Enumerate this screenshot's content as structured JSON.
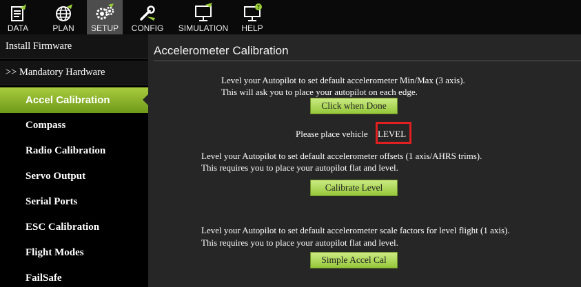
{
  "toolbar": {
    "items": [
      {
        "label": "DATA",
        "icon": "data-icon"
      },
      {
        "label": "PLAN",
        "icon": "globe-icon"
      },
      {
        "label": "SETUP",
        "icon": "gears-icon",
        "active": true
      },
      {
        "label": "CONFIG",
        "icon": "wrench-plane-icon"
      },
      {
        "label": "SIMULATION",
        "icon": "monitor-plane-icon"
      },
      {
        "label": "HELP",
        "icon": "monitor-help-icon"
      }
    ]
  },
  "sidebar": {
    "items": [
      {
        "label": "Install Firmware"
      },
      {
        "label": ">> Mandatory Hardware"
      },
      {
        "label": "Accel Calibration",
        "selected": true
      },
      {
        "label": "Compass"
      },
      {
        "label": "Radio Calibration"
      },
      {
        "label": "Servo Output"
      },
      {
        "label": "Serial Ports"
      },
      {
        "label": "ESC Calibration"
      },
      {
        "label": "Flight Modes"
      },
      {
        "label": "FailSafe"
      }
    ]
  },
  "main": {
    "title": "Accelerometer Calibration",
    "section1": {
      "line1": "Level your Autopilot to set default accelerometer Min/Max (3 axis).",
      "line2": "This will ask you to place your autopilot on each edge.",
      "button": "Click when Done",
      "prompt_text": "Please place vehicle",
      "prompt_value": "LEVEL"
    },
    "section2": {
      "line1": "Level your Autopilot to set default accelerometer offsets (1 axis/AHRS trims).",
      "line2": "This requires you to place your autopilot flat and level.",
      "button": "Calibrate Level"
    },
    "section3": {
      "line1": "Level your Autopilot to set default accelerometer scale factors for level flight (1 axis).",
      "line2": "This requires you to place your autopilot flat and level.",
      "button": "Simple Accel Cal"
    }
  },
  "colors": {
    "accent_green": "#8fbf2f",
    "highlight_red": "#e02020",
    "panel_bg": "#262626"
  }
}
